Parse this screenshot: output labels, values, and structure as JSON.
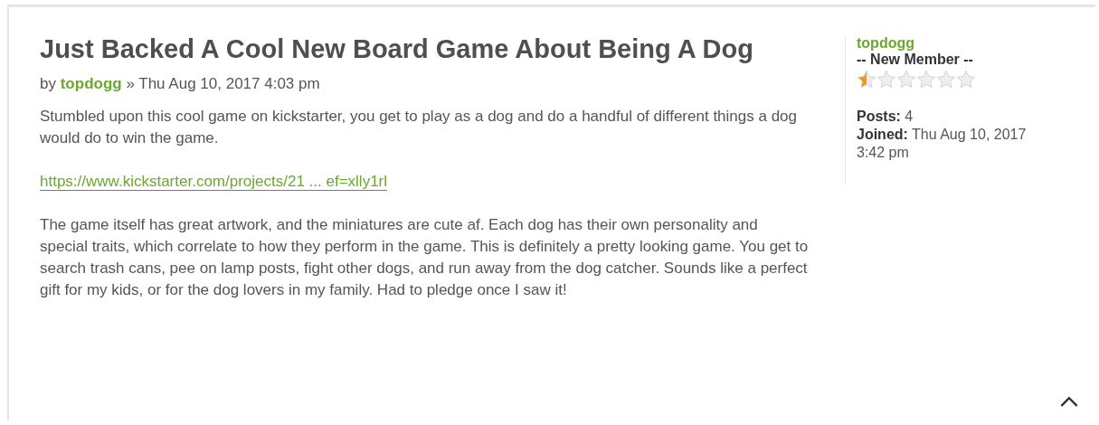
{
  "post": {
    "title": "Just Backed A Cool New Board Game About Being A Dog",
    "byline": {
      "prefix": "by",
      "author": "topdogg",
      "date": "» Thu Aug 10, 2017 4:03 pm"
    },
    "paragraphs": [
      {
        "kind": "text",
        "text": "Stumbled upon this cool game on kickstarter, you get to play as a dog and do a handful of different things a dog would do to win the game."
      },
      {
        "kind": "link",
        "text": "https://www.kickstarter.com/projects/21 ... ef=xlly1rl"
      },
      {
        "kind": "text",
        "text": "The game itself has great artwork, and the miniatures are cute af. Each dog has their own personality and special traits, which correlate to how they perform in the game. This is definitely a pretty looking game. You get to search trash cans, pee on lamp posts, fight other dogs, and run away from the dog catcher. Sounds like a perfect gift for my kids, or for the dog lovers in my family. Had to pledge once I saw it!"
      }
    ]
  },
  "profile": {
    "username": "topdogg",
    "rank": "-- New Member --",
    "stars": 0.5,
    "details": [
      {
        "label": "Posts:",
        "value": "4"
      },
      {
        "label": "Joined:",
        "value": "Thu Aug 10, 2017 3:42 pm"
      }
    ]
  }
}
